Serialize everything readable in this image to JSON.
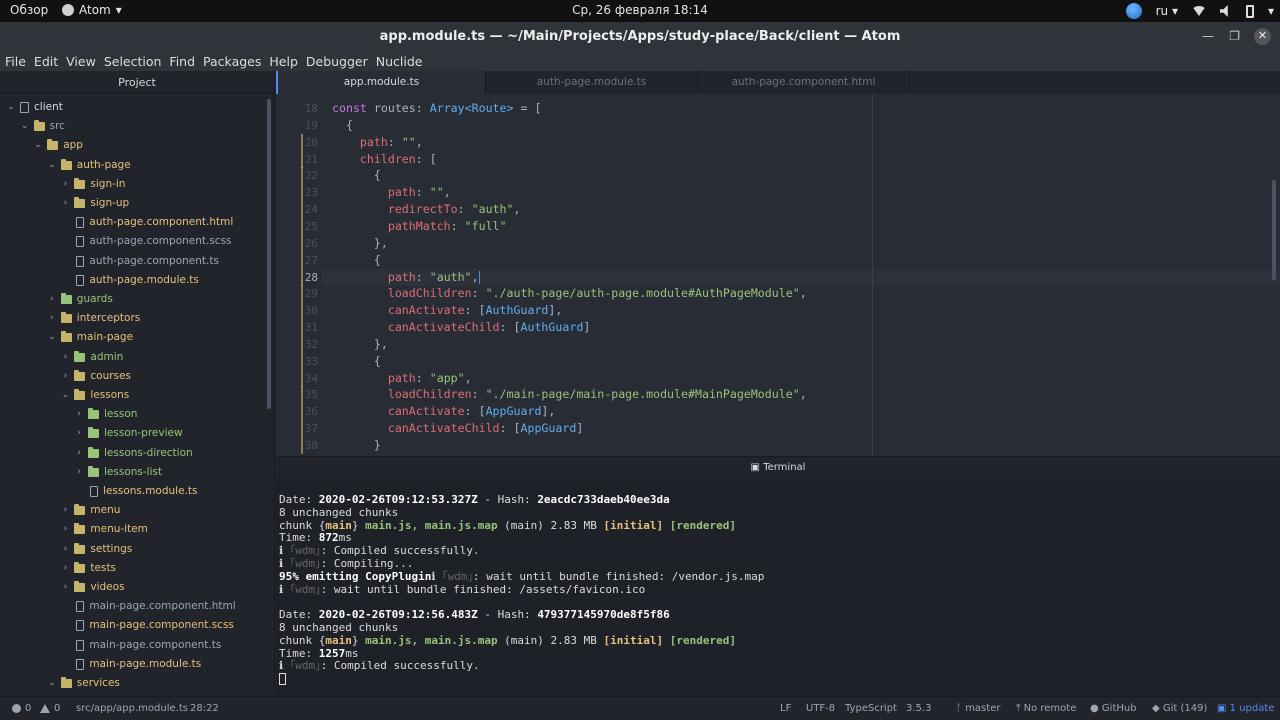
{
  "system_bar": {
    "activities": "Обзор",
    "app_name": "Atom",
    "clock": "Ср, 26 февраля  18:14",
    "lang": "ru"
  },
  "window": {
    "title": "app.module.ts — ~/Main/Projects/Apps/study-place/Back/client — Atom"
  },
  "menu": [
    "File",
    "Edit",
    "View",
    "Selection",
    "Find",
    "Packages",
    "Help",
    "Debugger",
    "Nuclide"
  ],
  "sidebar": {
    "title": "Project",
    "tree": [
      {
        "label": "client",
        "indent": 0,
        "kind": "repo",
        "expanded": true,
        "color": "plain"
      },
      {
        "label": "src",
        "indent": 1,
        "kind": "folder",
        "expanded": true,
        "color": "plain"
      },
      {
        "label": "app",
        "indent": 2,
        "kind": "folder",
        "expanded": true,
        "color": "yellow"
      },
      {
        "label": "auth-page",
        "indent": 3,
        "kind": "folder",
        "expanded": true,
        "color": "yellow"
      },
      {
        "label": "sign-in",
        "indent": 4,
        "kind": "folder",
        "expanded": false,
        "color": "yellow"
      },
      {
        "label": "sign-up",
        "indent": 4,
        "kind": "folder",
        "expanded": false,
        "color": "yellow"
      },
      {
        "label": "auth-page.component.html",
        "indent": 4,
        "kind": "file",
        "color": "yellow"
      },
      {
        "label": "auth-page.component.scss",
        "indent": 4,
        "kind": "file",
        "color": "plain"
      },
      {
        "label": "auth-page.component.ts",
        "indent": 4,
        "kind": "file",
        "color": "plain"
      },
      {
        "label": "auth-page.module.ts",
        "indent": 4,
        "kind": "file",
        "color": "yellow"
      },
      {
        "label": "guards",
        "indent": 3,
        "kind": "folder",
        "expanded": false,
        "color": "green"
      },
      {
        "label": "interceptors",
        "indent": 3,
        "kind": "folder",
        "expanded": false,
        "color": "yellow"
      },
      {
        "label": "main-page",
        "indent": 3,
        "kind": "folder",
        "expanded": true,
        "color": "yellow"
      },
      {
        "label": "admin",
        "indent": 4,
        "kind": "folder",
        "expanded": false,
        "color": "green"
      },
      {
        "label": "courses",
        "indent": 4,
        "kind": "folder",
        "expanded": false,
        "color": "yellow"
      },
      {
        "label": "lessons",
        "indent": 4,
        "kind": "folder",
        "expanded": true,
        "color": "yellow"
      },
      {
        "label": "lesson",
        "indent": 5,
        "kind": "folder",
        "expanded": false,
        "color": "green"
      },
      {
        "label": "lesson-preview",
        "indent": 5,
        "kind": "folder",
        "expanded": false,
        "color": "green"
      },
      {
        "label": "lessons-direction",
        "indent": 5,
        "kind": "folder",
        "expanded": false,
        "color": "green"
      },
      {
        "label": "lessons-list",
        "indent": 5,
        "kind": "folder",
        "expanded": false,
        "color": "green"
      },
      {
        "label": "lessons.module.ts",
        "indent": 5,
        "kind": "file",
        "color": "yellow"
      },
      {
        "label": "menu",
        "indent": 4,
        "kind": "folder",
        "expanded": false,
        "color": "yellow"
      },
      {
        "label": "menu-item",
        "indent": 4,
        "kind": "folder",
        "expanded": false,
        "color": "yellow"
      },
      {
        "label": "settings",
        "indent": 4,
        "kind": "folder",
        "expanded": false,
        "color": "yellow"
      },
      {
        "label": "tests",
        "indent": 4,
        "kind": "folder",
        "expanded": false,
        "color": "yellow"
      },
      {
        "label": "videos",
        "indent": 4,
        "kind": "folder",
        "expanded": false,
        "color": "yellow"
      },
      {
        "label": "main-page.component.html",
        "indent": 4,
        "kind": "file",
        "color": "plain"
      },
      {
        "label": "main-page.component.scss",
        "indent": 4,
        "kind": "file",
        "color": "yellow"
      },
      {
        "label": "main-page.component.ts",
        "indent": 4,
        "kind": "file",
        "color": "plain"
      },
      {
        "label": "main-page.module.ts",
        "indent": 4,
        "kind": "file",
        "color": "yellow"
      },
      {
        "label": "services",
        "indent": 3,
        "kind": "folder",
        "expanded": true,
        "color": "yellow"
      }
    ]
  },
  "tabs": [
    {
      "label": "app.module.ts",
      "active": true
    },
    {
      "label": "auth-page.module.ts",
      "active": false
    },
    {
      "label": "auth-page.component.html",
      "active": false
    }
  ],
  "editor": {
    "current_line": "28",
    "lines": [
      {
        "n": "18",
        "indent": 0,
        "tokens": [
          [
            "k",
            "const"
          ],
          [
            "w",
            " routes: "
          ],
          [
            "t",
            "Array<Route>"
          ],
          [
            "w",
            " = ["
          ]
        ]
      },
      {
        "n": "19",
        "indent": 1,
        "tokens": [
          [
            "w",
            "{"
          ]
        ]
      },
      {
        "n": "20",
        "indent": 2,
        "tokens": [
          [
            "p",
            "path"
          ],
          [
            "w",
            ": "
          ],
          [
            "s",
            "\"\""
          ],
          [
            "w",
            ","
          ]
        ]
      },
      {
        "n": "21",
        "indent": 2,
        "tokens": [
          [
            "p",
            "children"
          ],
          [
            "w",
            ": ["
          ]
        ]
      },
      {
        "n": "22",
        "indent": 3,
        "tokens": [
          [
            "w",
            "{"
          ]
        ]
      },
      {
        "n": "23",
        "indent": 4,
        "tokens": [
          [
            "p",
            "path"
          ],
          [
            "w",
            ": "
          ],
          [
            "s",
            "\"\""
          ],
          [
            "w",
            ","
          ]
        ]
      },
      {
        "n": "24",
        "indent": 4,
        "tokens": [
          [
            "p",
            "redirectTo"
          ],
          [
            "w",
            ": "
          ],
          [
            "s",
            "\"auth\""
          ],
          [
            "w",
            ","
          ]
        ]
      },
      {
        "n": "25",
        "indent": 4,
        "tokens": [
          [
            "p",
            "pathMatch"
          ],
          [
            "w",
            ": "
          ],
          [
            "s",
            "\"full\""
          ]
        ]
      },
      {
        "n": "26",
        "indent": 3,
        "tokens": [
          [
            "w",
            "},"
          ]
        ]
      },
      {
        "n": "27",
        "indent": 3,
        "tokens": [
          [
            "w",
            "{"
          ]
        ]
      },
      {
        "n": "28",
        "indent": 4,
        "tokens": [
          [
            "p",
            "path"
          ],
          [
            "w",
            ": "
          ],
          [
            "s",
            "\"auth\""
          ],
          [
            "w",
            ","
          ]
        ]
      },
      {
        "n": "29",
        "indent": 4,
        "tokens": [
          [
            "p",
            "loadChildren"
          ],
          [
            "w",
            ": "
          ],
          [
            "s",
            "\"./auth-page/auth-page.module#AuthPageModule\""
          ],
          [
            "w",
            ","
          ]
        ]
      },
      {
        "n": "30",
        "indent": 4,
        "tokens": [
          [
            "p",
            "canActivate"
          ],
          [
            "w",
            ": ["
          ],
          [
            "t",
            "AuthGuard"
          ],
          [
            "w",
            "],"
          ]
        ]
      },
      {
        "n": "31",
        "indent": 4,
        "tokens": [
          [
            "p",
            "canActivateChild"
          ],
          [
            "w",
            ": ["
          ],
          [
            "t",
            "AuthGuard"
          ],
          [
            "w",
            "]"
          ]
        ]
      },
      {
        "n": "32",
        "indent": 3,
        "tokens": [
          [
            "w",
            "},"
          ]
        ]
      },
      {
        "n": "33",
        "indent": 3,
        "tokens": [
          [
            "w",
            "{"
          ]
        ]
      },
      {
        "n": "34",
        "indent": 4,
        "tokens": [
          [
            "p",
            "path"
          ],
          [
            "w",
            ": "
          ],
          [
            "s",
            "\"app\""
          ],
          [
            "w",
            ","
          ]
        ]
      },
      {
        "n": "35",
        "indent": 4,
        "tokens": [
          [
            "p",
            "loadChildren"
          ],
          [
            "w",
            ": "
          ],
          [
            "s",
            "\"./main-page/main-page.module#MainPageModule\""
          ],
          [
            "w",
            ","
          ]
        ]
      },
      {
        "n": "36",
        "indent": 4,
        "tokens": [
          [
            "p",
            "canActivate"
          ],
          [
            "w",
            ": ["
          ],
          [
            "t",
            "AppGuard"
          ],
          [
            "w",
            "],"
          ]
        ]
      },
      {
        "n": "37",
        "indent": 4,
        "tokens": [
          [
            "p",
            "canActivateChild"
          ],
          [
            "w",
            ": ["
          ],
          [
            "t",
            "AppGuard"
          ],
          [
            "w",
            "]"
          ]
        ]
      },
      {
        "n": "38",
        "indent": 3,
        "tokens": [
          [
            "w",
            "}"
          ]
        ]
      }
    ]
  },
  "terminal": {
    "title": "Terminal",
    "lines": [
      [
        [
          "w",
          "Date: "
        ],
        [
          "b",
          "2020-02-26T09:12:53.327Z"
        ],
        [
          "w",
          " - Hash: "
        ],
        [
          "b",
          "2eacdc733daeb40ee3da"
        ]
      ],
      [
        [
          "w",
          "8 unchanged chunks"
        ]
      ],
      [
        [
          "w",
          "chunk {"
        ],
        [
          "y",
          "main"
        ],
        [
          "w",
          "} "
        ],
        [
          "g",
          "main.js, main.js.map"
        ],
        [
          "w",
          " (main) 2.83 MB "
        ],
        [
          "y",
          "[initial]"
        ],
        [
          "w",
          " "
        ],
        [
          "g",
          "[rendered]"
        ]
      ],
      [
        [
          "w",
          "Time: "
        ],
        [
          "b",
          "872"
        ],
        [
          "w",
          "ms"
        ]
      ],
      [
        [
          "w",
          "ℹ "
        ],
        [
          "d",
          "｢wdm｣"
        ],
        [
          "w",
          ": Compiled successfully."
        ]
      ],
      [
        [
          "w",
          "ℹ "
        ],
        [
          "d",
          "｢wdm｣"
        ],
        [
          "w",
          ": Compiling..."
        ]
      ],
      [
        [
          "b",
          "95% emitting CopyPlugin"
        ],
        [
          "w",
          "ℹ "
        ],
        [
          "d",
          "｢wdm｣"
        ],
        [
          "w",
          ": wait until bundle finished: /vendor.js.map"
        ]
      ],
      [
        [
          "w",
          "ℹ "
        ],
        [
          "d",
          "｢wdm｣"
        ],
        [
          "w",
          ": wait until bundle finished: /assets/favicon.ico"
        ]
      ],
      [],
      [
        [
          "w",
          "Date: "
        ],
        [
          "b",
          "2020-02-26T09:12:56.483Z"
        ],
        [
          "w",
          " - Hash: "
        ],
        [
          "b",
          "479377145970de8f5f86"
        ]
      ],
      [
        [
          "w",
          "8 unchanged chunks"
        ]
      ],
      [
        [
          "w",
          "chunk {"
        ],
        [
          "y",
          "main"
        ],
        [
          "w",
          "} "
        ],
        [
          "g",
          "main.js, main.js.map"
        ],
        [
          "w",
          " (main) 2.83 MB "
        ],
        [
          "y",
          "[initial]"
        ],
        [
          "w",
          " "
        ],
        [
          "g",
          "[rendered]"
        ]
      ],
      [
        [
          "w",
          "Time: "
        ],
        [
          "b",
          "1257"
        ],
        [
          "w",
          "ms"
        ]
      ],
      [
        [
          "w",
          "ℹ "
        ],
        [
          "d",
          "｢wdm｣"
        ],
        [
          "w",
          ": Compiled successfully."
        ]
      ]
    ]
  },
  "statusbar": {
    "errors": "0",
    "warnings": "0",
    "file_path": "src/app/app.module.ts",
    "cursor_pos": "28:22",
    "line_ending": "LF",
    "encoding": "UTF-8",
    "grammar": "TypeScript",
    "ts_version": "3.5.3",
    "branch": "master",
    "remote": "No remote",
    "github": "GitHub",
    "git": "Git (149)",
    "updates": "1 update"
  }
}
